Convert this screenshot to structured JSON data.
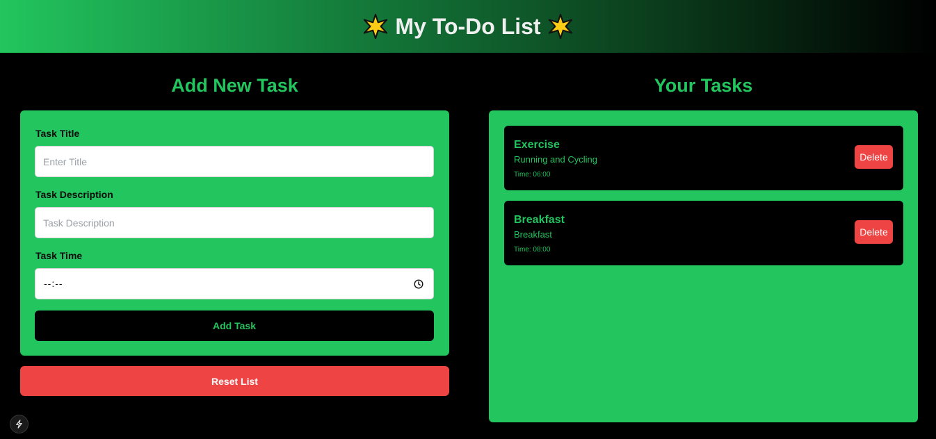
{
  "header": {
    "title": "My To-Do List",
    "icon_left": "star-icon",
    "icon_right": "star-icon"
  },
  "form": {
    "heading": "Add New Task",
    "title_label": "Task Title",
    "title_placeholder": "Enter Title",
    "description_label": "Task Description",
    "description_placeholder": "Task Description",
    "time_label": "Task Time",
    "time_value": "--:--",
    "add_button": "Add Task",
    "reset_button": "Reset List"
  },
  "tasks": {
    "heading": "Your Tasks",
    "items": [
      {
        "title": "Exercise",
        "description": "Running and Cycling",
        "time": "Time: 06:00",
        "delete_label": "Delete"
      },
      {
        "title": "Breakfast",
        "description": "Breakfast",
        "time": "Time: 08:00",
        "delete_label": "Delete"
      }
    ]
  },
  "colors": {
    "accent": "#22c55e",
    "danger": "#ef4444",
    "background": "#000000"
  }
}
